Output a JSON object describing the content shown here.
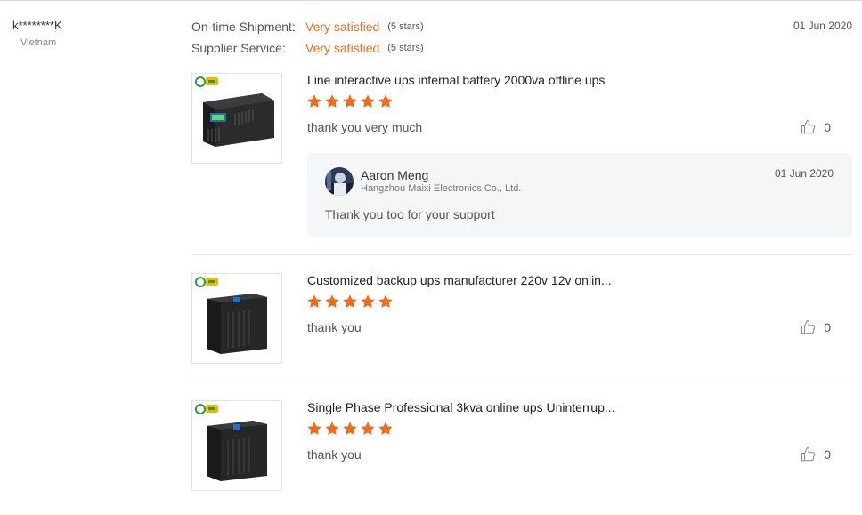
{
  "reviewer": {
    "name": "k********K",
    "country": "Vietnam"
  },
  "ratings": [
    {
      "label": "On-time Shipment:",
      "value": "Very satisfied",
      "stars_text": "(5 stars)"
    },
    {
      "label": "Supplier Service:",
      "value": "Very satisfied",
      "stars_text": "(5 stars)"
    }
  ],
  "review_date": "01 Jun 2020",
  "colors": {
    "accent": "#f06b1e",
    "star": "#f06b1e",
    "reply_bg": "#f5f6f7"
  },
  "icons": {
    "star": "star-icon",
    "like": "thumbs-up-icon",
    "logo": "brand-logo-icon"
  },
  "products": [
    {
      "title": "Line interactive ups internal battery 2000va offline ups",
      "rating": 5,
      "comment": "thank you very much",
      "likes": "0"
    },
    {
      "title": "Customized backup ups manufacturer 220v 12v onlin...",
      "rating": 5,
      "comment": "thank you",
      "likes": "0"
    },
    {
      "title": "Single Phase Professional 3kva online ups Uninterrup...",
      "rating": 5,
      "comment": "thank you",
      "likes": "0"
    }
  ],
  "reply": {
    "name": "Aaron Meng",
    "company": "Hangzhou Maixi Electronics Co., Ltd.",
    "date": "01 Jun 2020",
    "text": "Thank you too for your support"
  }
}
